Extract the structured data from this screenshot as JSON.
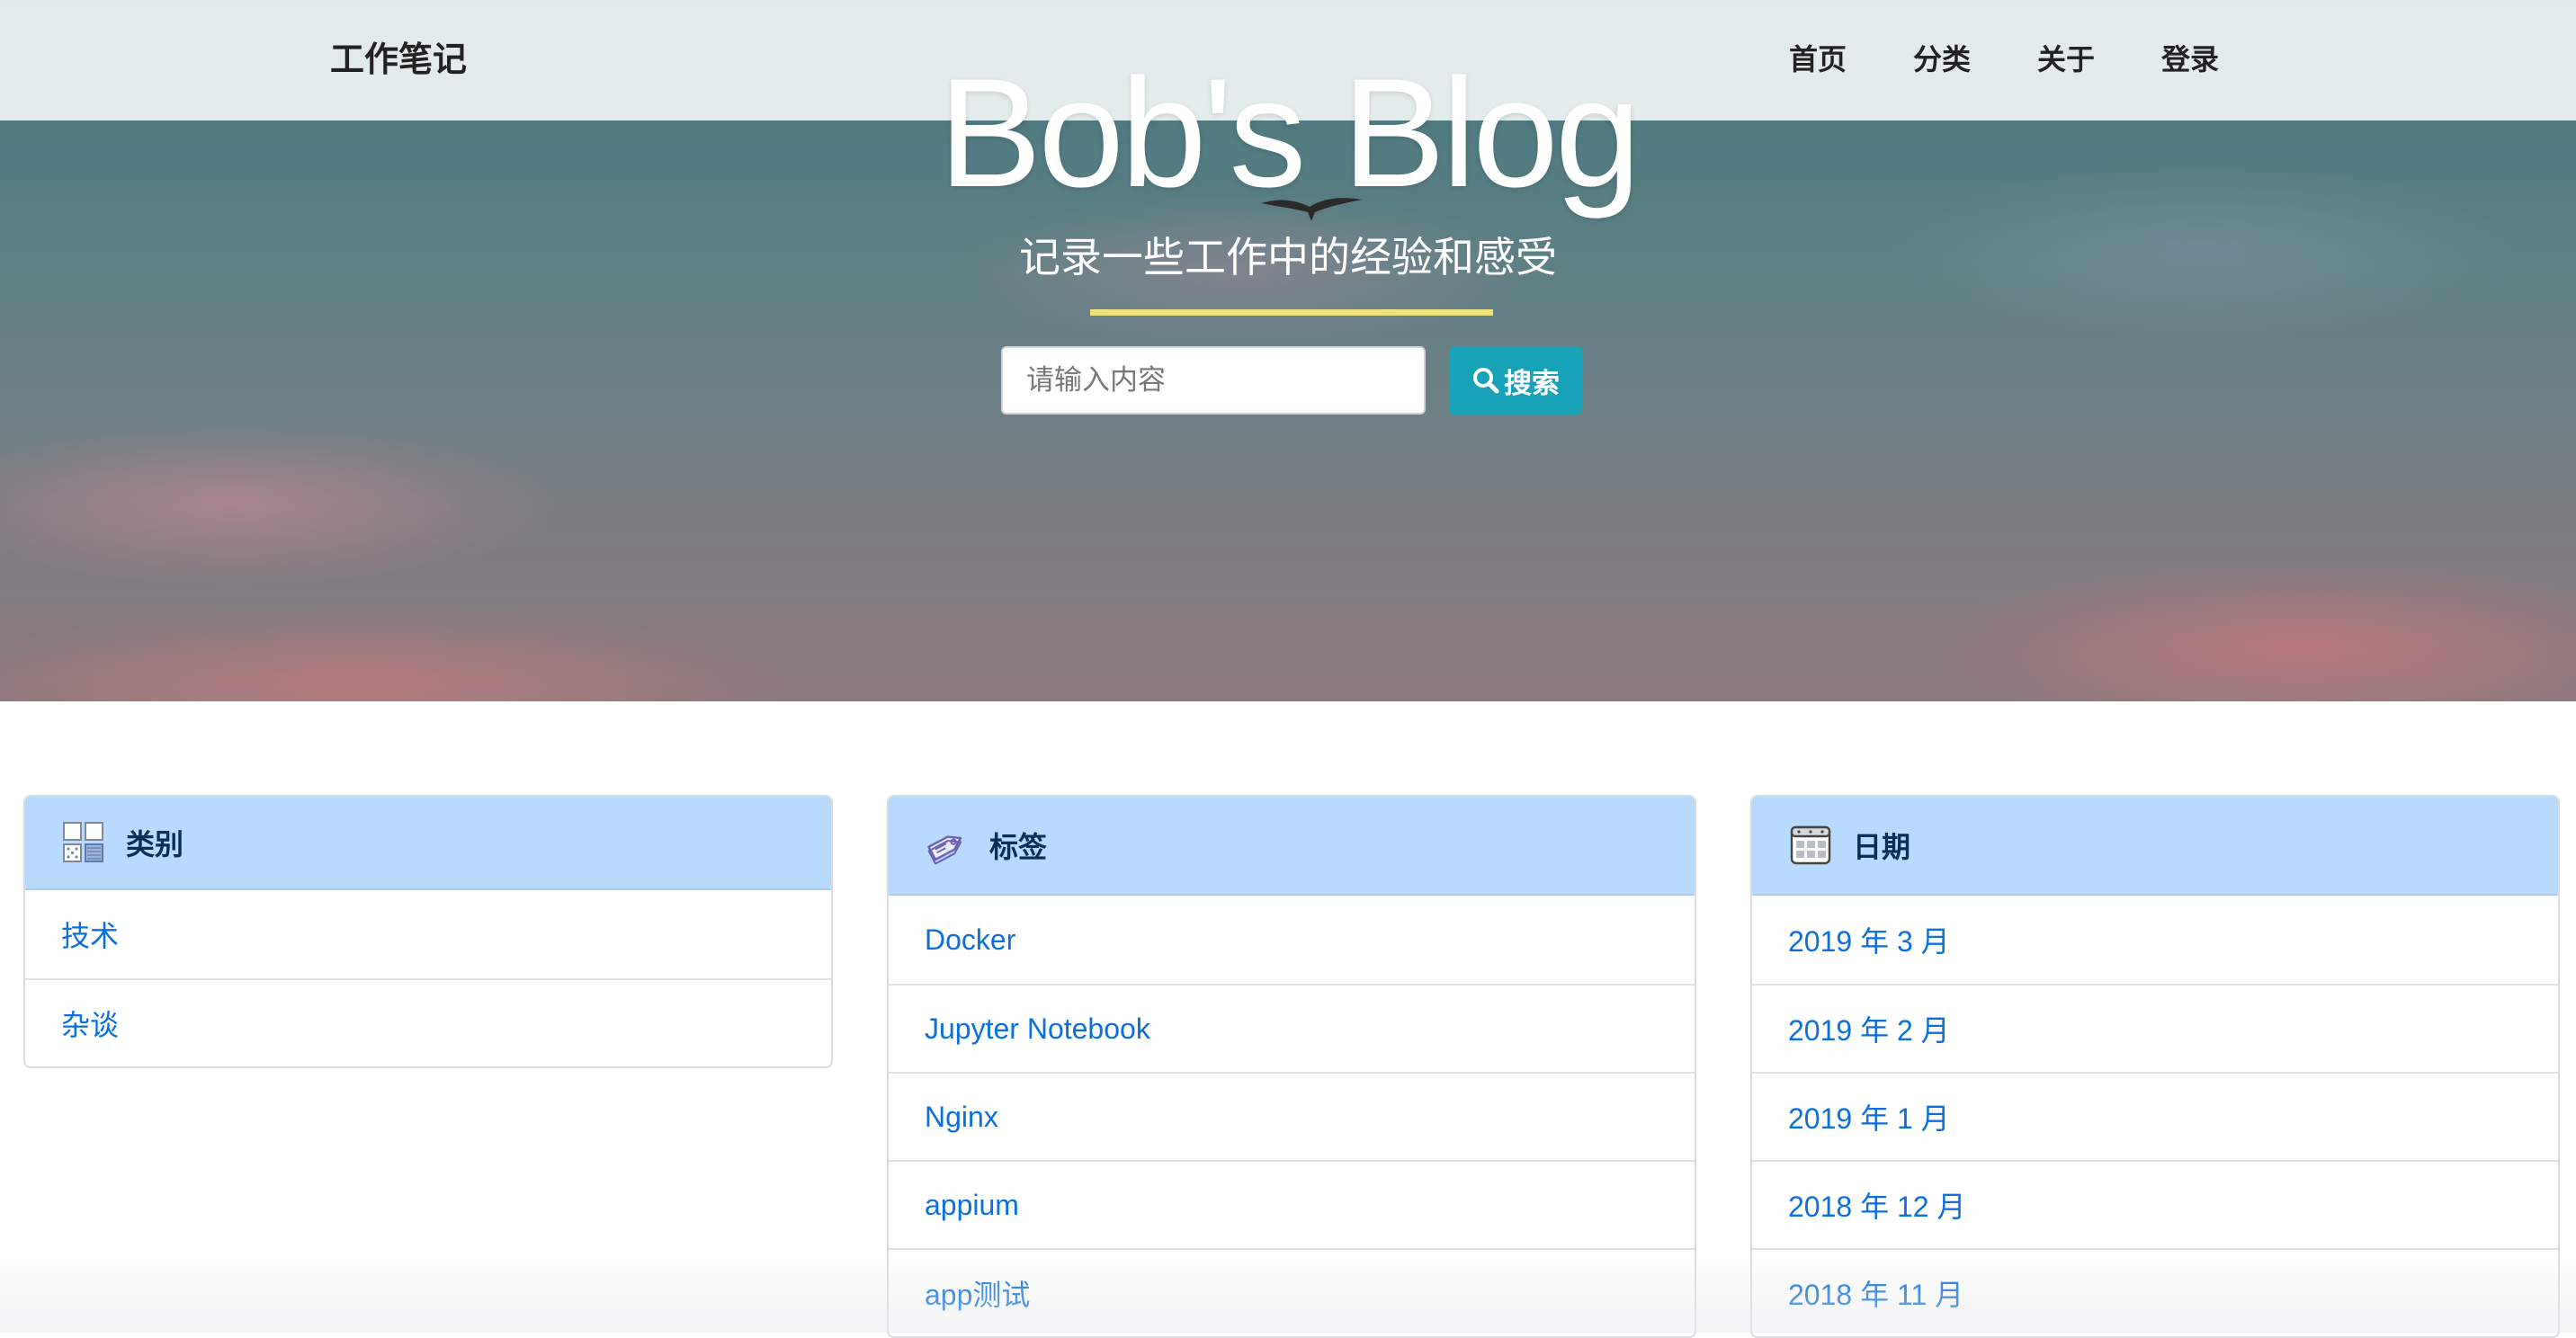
{
  "navbar": {
    "brand": "工作笔记",
    "links": [
      "首页",
      "分类",
      "关于",
      "登录"
    ]
  },
  "hero": {
    "title": "Bob's Blog",
    "subtitle": "记录一些工作中的经验和感受",
    "accent_color": "#f0e27a"
  },
  "search": {
    "placeholder": "请输入内容",
    "value": "",
    "button_label": "搜索",
    "button_icon": "search-icon",
    "button_color": "#17a2b8"
  },
  "cards": {
    "header_color": "#b8daff",
    "link_color": "#0b6fde",
    "categories": {
      "title": "类别",
      "icon": "category-grid-icon",
      "items": [
        "技术",
        "杂谈"
      ]
    },
    "tags": {
      "title": "标签",
      "icon": "tag-icon",
      "items": [
        "Docker",
        "Jupyter Notebook",
        "Nginx",
        "appium",
        "app测试"
      ]
    },
    "dates": {
      "title": "日期",
      "icon": "calendar-icon",
      "items": [
        "2019 年 3 月",
        "2019 年 2 月",
        "2019 年 1 月",
        "2018 年 12 月",
        "2018 年 11 月"
      ]
    }
  }
}
